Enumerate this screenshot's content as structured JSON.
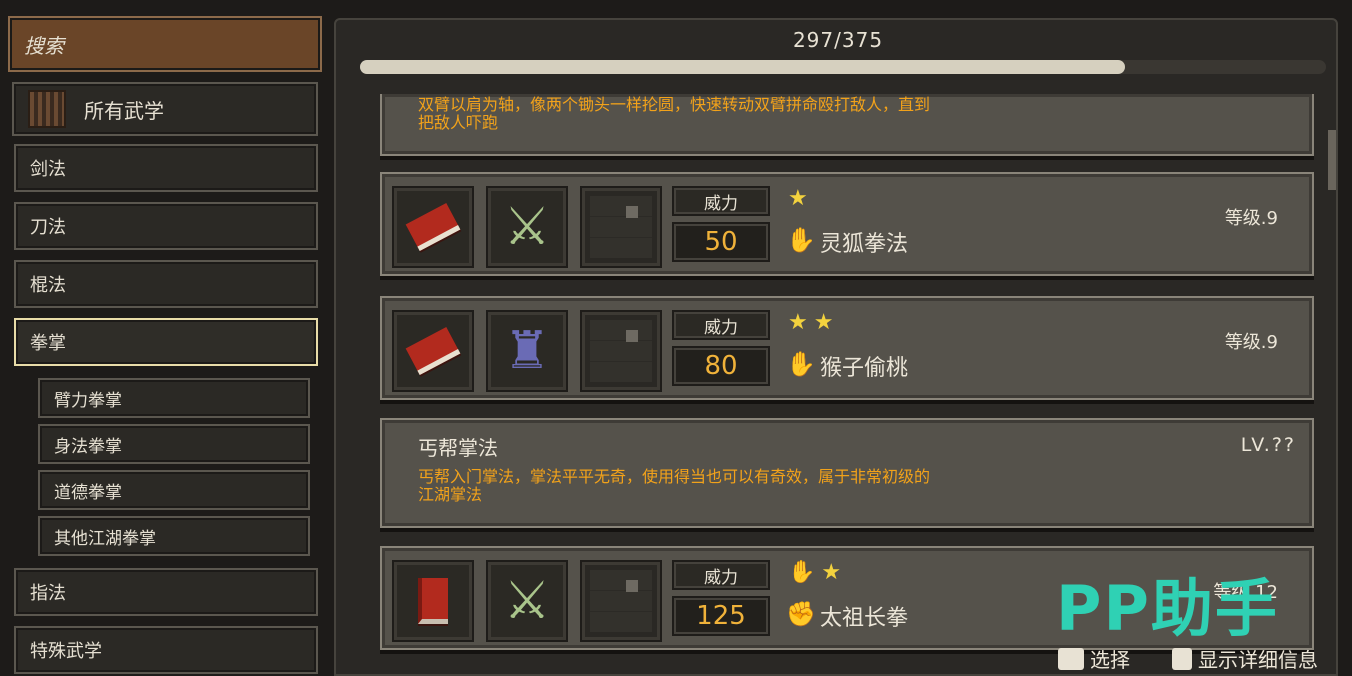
{
  "sidebar": {
    "search_label": "搜索",
    "all_label": "所有武学",
    "categories": [
      {
        "label": "剑法"
      },
      {
        "label": "刀法"
      },
      {
        "label": "棍法"
      },
      {
        "label": "拳掌"
      },
      {
        "label": "指法"
      },
      {
        "label": "特殊武学"
      }
    ],
    "subcategories": [
      {
        "label": "臂力拳掌"
      },
      {
        "label": "身法拳掌"
      },
      {
        "label": "道德拳掌"
      },
      {
        "label": "其他江湖拳掌"
      }
    ]
  },
  "main": {
    "progress_text": "297/375",
    "progress_fraction": 0.792,
    "top_desc_line1": "双臂以肩为轴，像两个锄头一样抡圆，快速转动双臂拼命殴打敌人，直到",
    "top_desc_line2": "把敌人吓跑",
    "skills": [
      {
        "power_label": "威力",
        "power": "50",
        "stars": "★",
        "hand_icon": "palm-icon",
        "name": "灵狐拳法",
        "grade": "等级.9",
        "figure": "green-warrior"
      },
      {
        "power_label": "威力",
        "power": "80",
        "stars": "★★",
        "hand_icon": "palm-icon",
        "name": "猴子偷桃",
        "grade": "等级.9",
        "figure": "purple-demon"
      }
    ],
    "info_card": {
      "title": "丐帮掌法",
      "level": "LV.??",
      "desc_line1": "丐帮入门掌法，掌法平平无奇，使用得当也可以有奇效，属于非常初级的",
      "desc_line2": "江湖掌法"
    },
    "skill3": {
      "power_label": "威力",
      "power": "125",
      "stars": "★",
      "hand_icon": "fist-icon",
      "name": "太祖长拳",
      "grade": "等级.12",
      "figure": "green-warrior"
    }
  },
  "hints": {
    "select": "选择",
    "details": "显示详细信息"
  },
  "watermark": "PP助手",
  "colors": {
    "accent_orange": "#f2a21a",
    "star_yellow": "#f3d23e",
    "watermark": "#2fd1b4"
  }
}
